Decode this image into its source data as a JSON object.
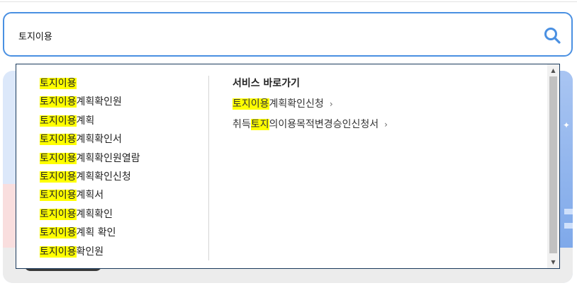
{
  "search": {
    "value": "토지이용",
    "highlight_color": "#ffff00",
    "accent_color": "#4a90e2",
    "button_icon": "search-icon"
  },
  "suggestions": [
    {
      "hl": "토지이용",
      "rest": ""
    },
    {
      "hl": "토지이용",
      "rest": "계획확인원"
    },
    {
      "hl": "토지이용",
      "rest": "계획"
    },
    {
      "hl": "토지이용",
      "rest": "계획확인서"
    },
    {
      "hl": "토지이용",
      "rest": "계획확인원열람"
    },
    {
      "hl": "토지이용",
      "rest": "계획확인신청"
    },
    {
      "hl": "토지이용",
      "rest": "계획서"
    },
    {
      "hl": "토지이용",
      "rest": "계획확인"
    },
    {
      "hl": "토지이용",
      "rest": "계획 확인"
    },
    {
      "hl": "토지이용",
      "rest": "확인원"
    }
  ],
  "services": {
    "title": "서비스 바로가기",
    "items": [
      {
        "pre": "",
        "hl": "토지이용",
        "post": "계획확인신청",
        "chevron": "›"
      },
      {
        "pre": "취득",
        "hl": "토지",
        "post": "의이용목적변경승인신청서",
        "chevron": "›"
      }
    ]
  },
  "scrollbar": {
    "up": "▲",
    "down": "▼"
  }
}
